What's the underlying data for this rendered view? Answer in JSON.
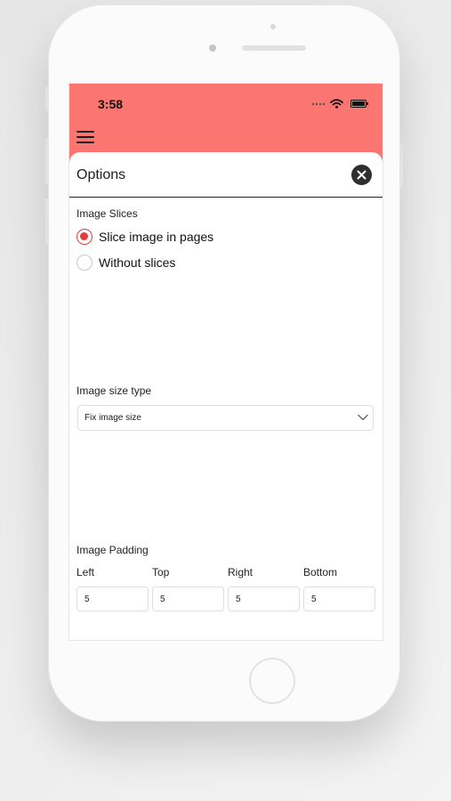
{
  "status_bar": {
    "time": "3:58",
    "icons": [
      "signal-dots-icon",
      "wifi-icon",
      "battery-icon"
    ]
  },
  "header": {
    "menu_icon": "hamburger-menu-icon"
  },
  "colors": {
    "header": "#fb7571",
    "accent": "#e23c3c",
    "close_button": "#2f2f2f"
  },
  "sheet": {
    "title": "Options",
    "close_icon": "close-icon",
    "image_slices": {
      "label": "Image Slices",
      "options": [
        {
          "label": "Slice image in pages",
          "selected": true
        },
        {
          "label": "Without slices",
          "selected": false
        }
      ]
    },
    "image_size_type": {
      "label": "Image size type",
      "selected": "Fix image size",
      "icon": "chevron-down-icon"
    },
    "image_padding": {
      "label": "Image Padding",
      "fields": [
        {
          "label": "Left",
          "value": "5"
        },
        {
          "label": "Top",
          "value": "5"
        },
        {
          "label": "Right",
          "value": "5"
        },
        {
          "label": "Bottom",
          "value": "5"
        }
      ]
    }
  }
}
